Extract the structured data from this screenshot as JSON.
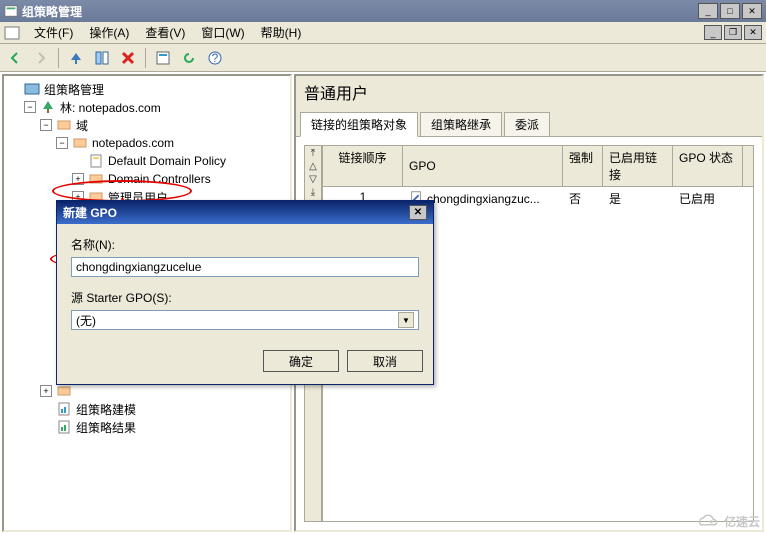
{
  "window": {
    "title": "组策略管理"
  },
  "menus": {
    "file": "文件(F)",
    "action": "操作(A)",
    "view": "查看(V)",
    "window": "窗口(W)",
    "help": "帮助(H)"
  },
  "tree": {
    "root": "组策略管理",
    "forest": "林: notepados.com",
    "domains": "域",
    "domain": "notepados.com",
    "ddp": "Default Domain Policy",
    "dc": "Domain Controllers",
    "admin_ou": "管理员用户",
    "user_ou": "普通用户",
    "gpmodel": "组策略建模",
    "gpresult": "组策略结果"
  },
  "panel": {
    "header": "普通用户",
    "tabs": {
      "linked": "链接的组策略对象",
      "inherit": "组策略继承",
      "delegate": "委派"
    },
    "columns": {
      "order": "链接顺序",
      "gpo": "GPO",
      "enforced": "强制",
      "linkenabled": "已启用链接",
      "status": "GPO 状态"
    },
    "row": {
      "order": "1",
      "gpo": "chongdingxiangzuc...",
      "enforced": "否",
      "linkenabled": "是",
      "status": "已启用"
    }
  },
  "dialog": {
    "title": "新建 GPO",
    "name_label": "名称(N):",
    "name_value": "chongdingxiangzucelue",
    "starter_label": "源 Starter GPO(S):",
    "starter_value": "(无)",
    "ok": "确定",
    "cancel": "取消"
  },
  "watermark": "亿速云"
}
